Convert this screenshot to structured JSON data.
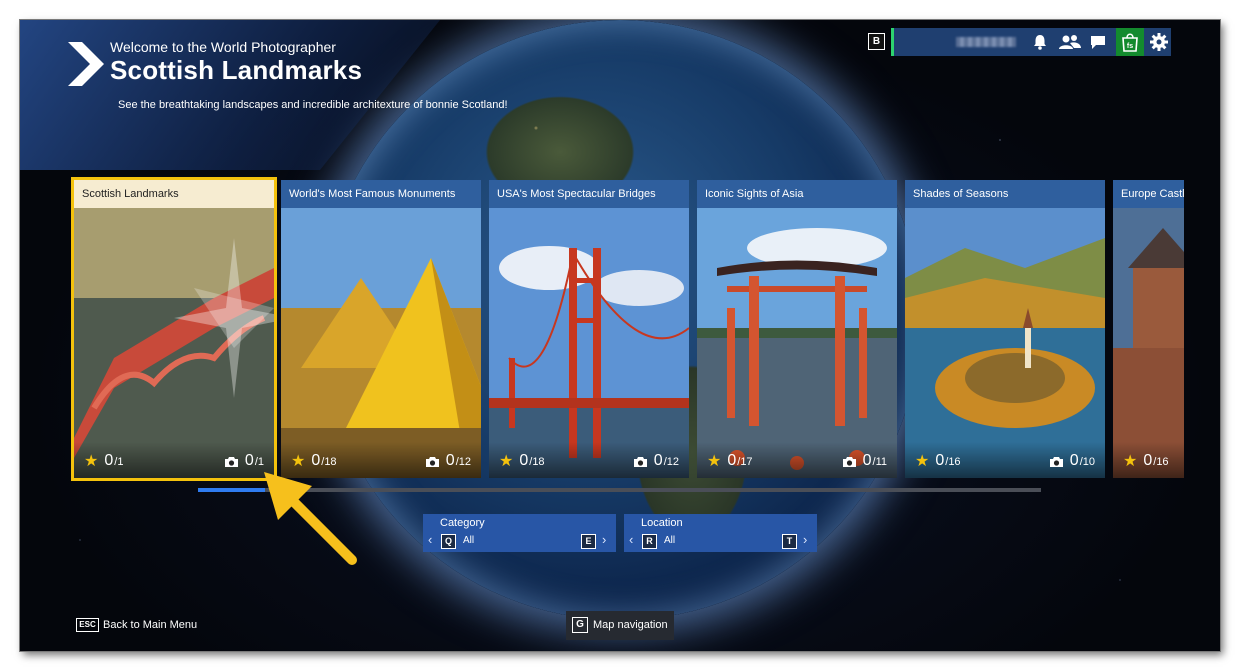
{
  "header": {
    "welcome": "Welcome to the World Photographer",
    "title": "Scottish Landmarks",
    "subtitle": "See the breathtaking landscapes and incredible architexture of bonnie Scotland!"
  },
  "topbar": {
    "key_hint": "B",
    "icons": [
      "bell-icon",
      "friends-icon",
      "chat-icon",
      "shop-icon",
      "settings-icon"
    ]
  },
  "cards": [
    {
      "title": "Scottish Landmarks",
      "stars": "0",
      "stars_total": "1",
      "photos": "0",
      "photos_total": "1"
    },
    {
      "title": "World's Most Famous Monuments",
      "stars": "0",
      "stars_total": "18",
      "photos": "0",
      "photos_total": "12"
    },
    {
      "title": "USA's Most Spectacular Bridges",
      "stars": "0",
      "stars_total": "18",
      "photos": "0",
      "photos_total": "12"
    },
    {
      "title": "Iconic Sights of Asia",
      "stars": "0",
      "stars_total": "17",
      "photos": "0",
      "photos_total": "11"
    },
    {
      "title": "Shades of Seasons",
      "stars": "0",
      "stars_total": "16",
      "photos": "0",
      "photos_total": "10"
    },
    {
      "title": "Europe Castles",
      "stars": "0",
      "stars_total": "16"
    }
  ],
  "carousel": {
    "progress": 0.08
  },
  "filters": {
    "category": {
      "label": "Category",
      "value": "All",
      "prev_key": "Q",
      "next_key": "E"
    },
    "location": {
      "label": "Location",
      "value": "All",
      "prev_key": "R",
      "next_key": "T"
    }
  },
  "footer": {
    "esc_key": "ESC",
    "back_label": "Back to Main Menu",
    "map_key": "G",
    "map_label": "Map navigation"
  },
  "colors": {
    "accent_blue": "#2f7cf0",
    "selected_border": "#f4c20d",
    "shop_green": "#138a2e",
    "panel_blue": "#2856a6"
  }
}
